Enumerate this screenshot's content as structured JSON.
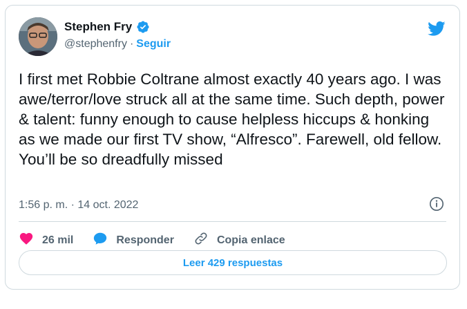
{
  "author": {
    "name": "Stephen Fry",
    "handle": "@stephenfry",
    "separator": "·",
    "follow_label": "Seguir"
  },
  "tweet": {
    "text": "I first met Robbie Coltrane almost exactly 40 years ago. I was awe/terror/love struck all at the same time. Such depth, power & talent: funny enough to cause helpless hiccups & honking as we made our first TV show, “Alfresco”. Farewell, old fellow. You’ll be so dreadfully missed",
    "timestamp": "1:56 p. m. · 14 oct. 2022"
  },
  "actions": {
    "likes": "26 mil",
    "reply_label": "Responder",
    "copy_link_label": "Copia enlace"
  },
  "replies_button": "Leer 429 respuestas",
  "colors": {
    "accent": "#1d9bf0",
    "like": "#f91880",
    "text": "#0f1419",
    "secondary": "#536471",
    "border": "#cfd9de"
  },
  "icons": [
    "verified-badge-icon",
    "twitter-bird-icon",
    "info-icon",
    "heart-icon",
    "reply-bubble-icon",
    "link-icon"
  ]
}
